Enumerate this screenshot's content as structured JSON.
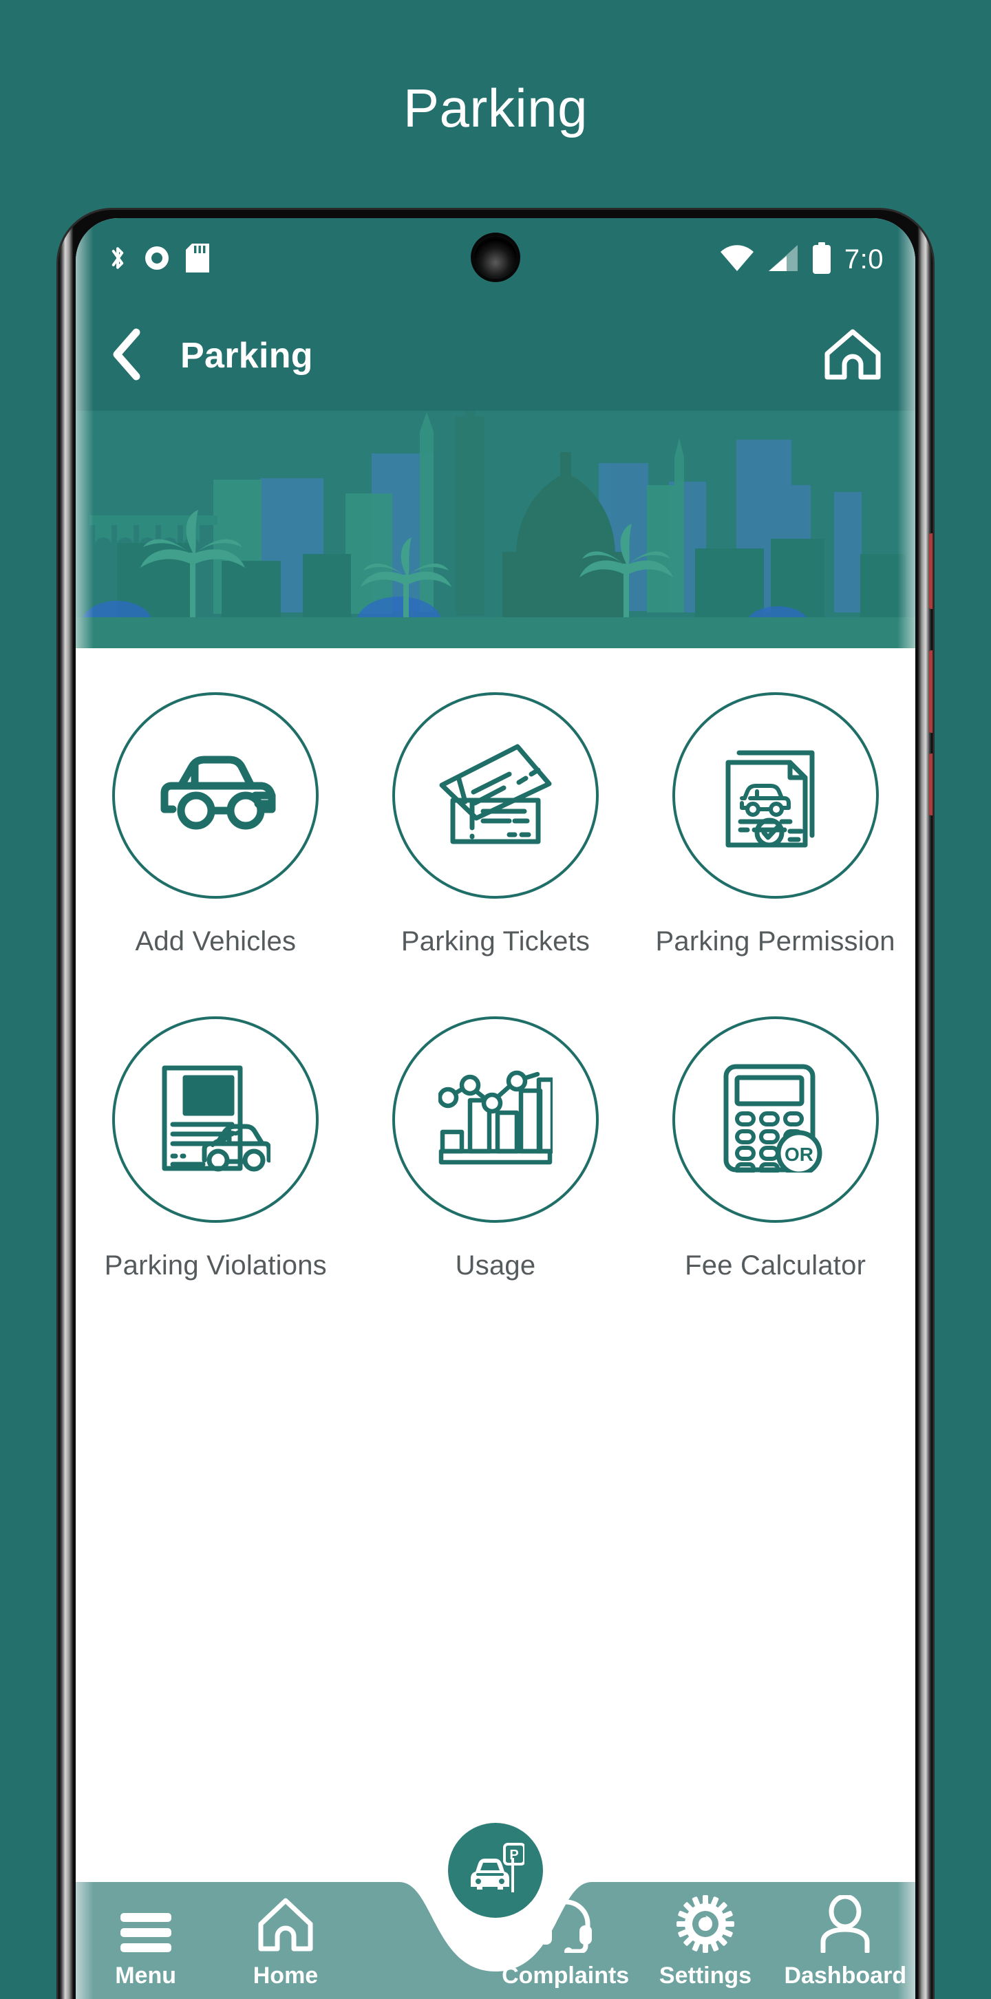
{
  "page": {
    "title": "Parking",
    "background_color": "#23706C"
  },
  "phone": {
    "status_bar": {
      "time": "7:0",
      "icons": [
        "bluetooth-icon",
        "record-icon",
        "sd-card-icon",
        "wifi-icon",
        "cellular-signal-icon",
        "battery-icon"
      ]
    },
    "app_bar": {
      "back_icon": "chevron-left-icon",
      "title": "Parking",
      "home_icon": "home-icon"
    },
    "hero": {
      "alt": "city-skyline-banner",
      "background_color": "#2A7E77"
    },
    "grid": {
      "rows": [
        [
          {
            "id": "add-vehicles",
            "label": "Add Vehicles",
            "icon": "car-icon"
          },
          {
            "id": "parking-tickets",
            "label": "Parking Tickets",
            "icon": "tickets-icon"
          },
          {
            "id": "parking-permission",
            "label": "Parking Permission",
            "icon": "permission-document-icon"
          }
        ],
        [
          {
            "id": "parking-violations",
            "label": "Parking Violations",
            "icon": "violation-document-icon"
          },
          {
            "id": "usage",
            "label": "Usage",
            "icon": "bar-chart-icon"
          },
          {
            "id": "fee-calculator",
            "label": "Fee Calculator",
            "icon": "calculator-or-icon"
          }
        ]
      ],
      "accent_color": "#1F6F68",
      "label_color": "#555A5D"
    },
    "bottom_nav": {
      "background_color": "#6FA3A0",
      "fab": {
        "id": "parking-fab",
        "icon": "car-parking-sign-icon",
        "color": "#2D7E77"
      },
      "items": [
        {
          "id": "menu",
          "label": "Menu",
          "icon": "hamburger-menu-icon"
        },
        {
          "id": "home",
          "label": "Home",
          "icon": "home-icon"
        },
        {
          "id": "complaints",
          "label": "Complaints",
          "icon": "headset-icon"
        },
        {
          "id": "settings",
          "label": "Settings",
          "icon": "gear-icon"
        },
        {
          "id": "dashboard",
          "label": "Dashboard",
          "icon": "person-icon"
        }
      ]
    }
  }
}
